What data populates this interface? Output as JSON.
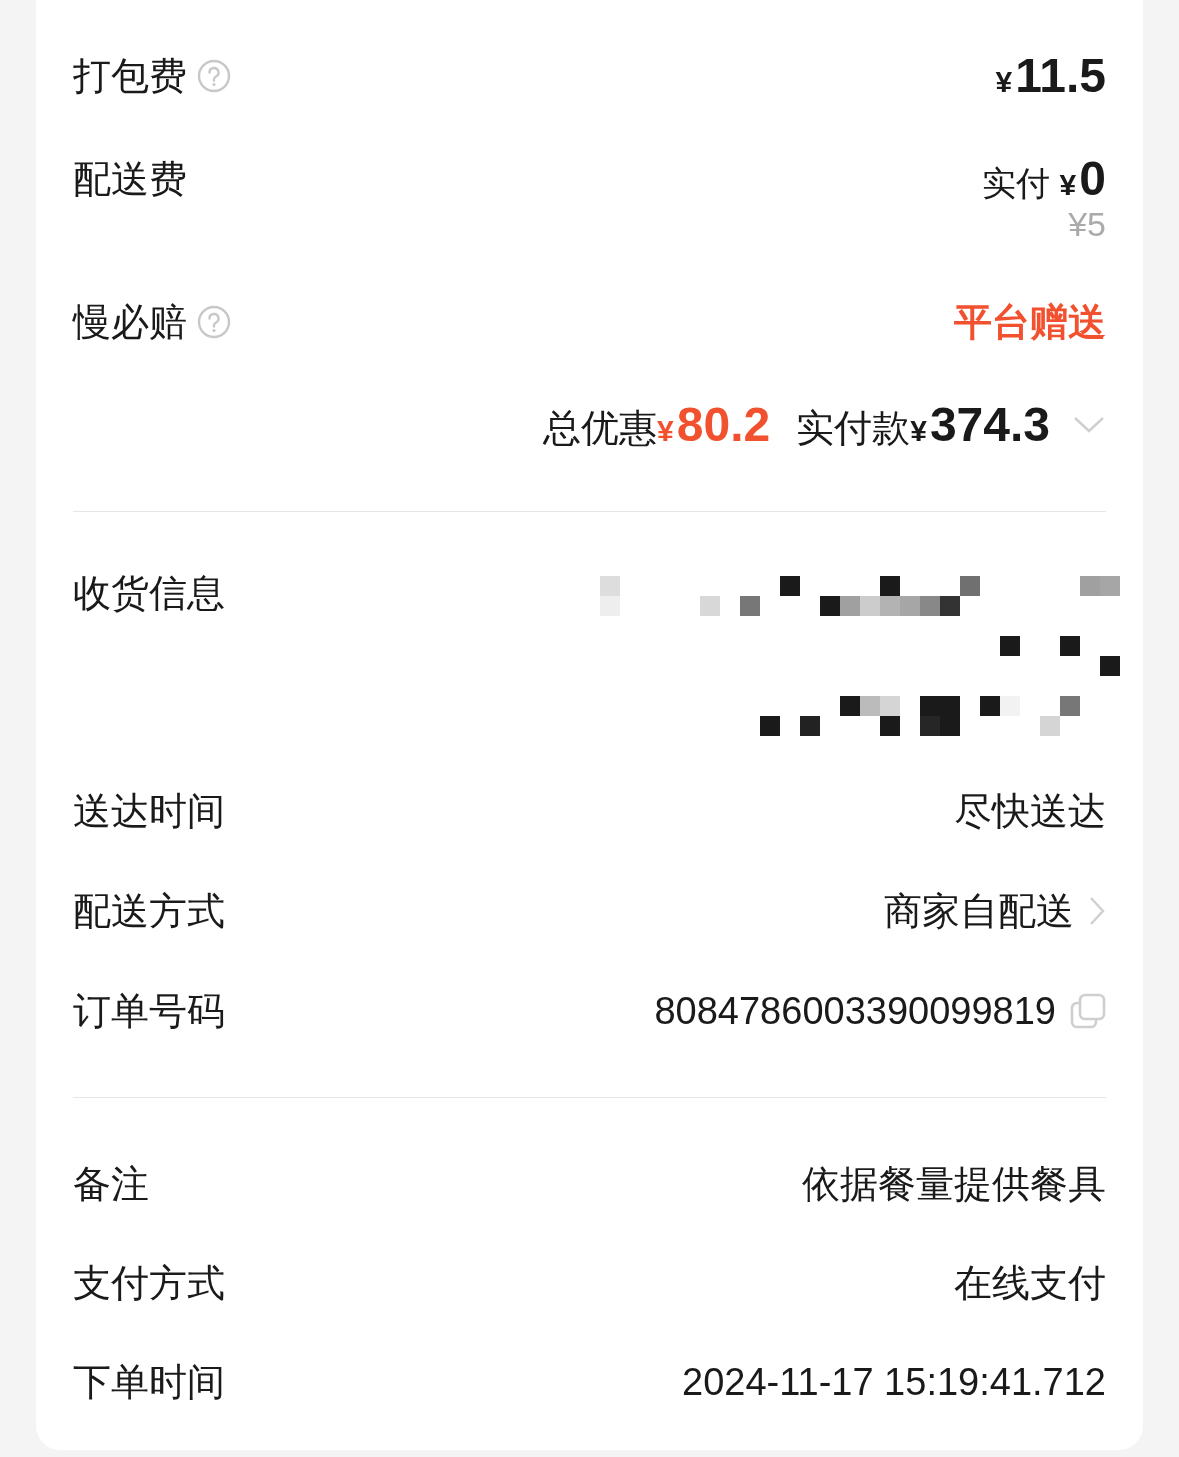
{
  "fees": [
    {
      "label": "打包费",
      "help": true,
      "kind": "amount",
      "currency": "¥",
      "value": "11.5"
    },
    {
      "label": "配送费",
      "help": false,
      "kind": "discounted",
      "paid_label": "实付",
      "currency": "¥",
      "value": "0",
      "original": "¥5"
    },
    {
      "label": "慢必赔",
      "help": true,
      "kind": "promo",
      "value": "平台赠送"
    }
  ],
  "summary": {
    "discount_label": "总优惠",
    "discount_currency": "¥",
    "discount": "80.2",
    "paid_label": "实付款",
    "paid_currency": "¥",
    "paid": "374.3",
    "expanded": false
  },
  "delivery": [
    {
      "label": "收货信息",
      "kind": "redacted"
    },
    {
      "label": "送达时间",
      "kind": "text",
      "value": "尽快送达"
    },
    {
      "label": "配送方式",
      "kind": "link",
      "value": "商家自配送"
    },
    {
      "label": "订单号码",
      "kind": "copy",
      "value": "8084786003390099819"
    }
  ],
  "extra": [
    {
      "label": "备注",
      "kind": "text",
      "value": "依据餐量提供餐具"
    },
    {
      "label": "支付方式",
      "kind": "text",
      "value": "在线支付"
    },
    {
      "label": "下单时间",
      "kind": "text",
      "value": "2024-11-17 15:19:41.712"
    }
  ]
}
